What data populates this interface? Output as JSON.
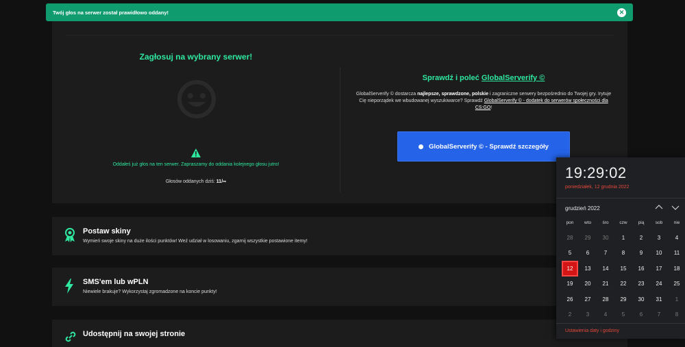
{
  "toast": {
    "message": "Twój głos na serwer został prawidłowo oddany!"
  },
  "vote": {
    "title": "Zagłosuj na wybrany serwer!",
    "message": "Oddałeś już głos na ten serwer. Zapraszamy do oddania kolejnego głosu jutro!",
    "votes_label": "Głosów oddanych dziś:",
    "votes_value": "11/∞"
  },
  "globalserverify": {
    "title_prefix": "Sprawdź i poleć",
    "title_link": "GlobalServerify ©",
    "desc_1": "GlobalServerify © dostarcza",
    "desc_bold": "najlepsze, sprawdzone, polskie",
    "desc_2": "i zagraniczne serwery bezpośrednio do Twojej gry.",
    "desc_3": "Irytuje Cię nieporządek we wbudowanej wyszukiwarce? Sprawdź",
    "desc_link": "GlobalServerify © - dodatek do serwerów społeczności dla CS:GO",
    "desc_end": "!",
    "button_label": "GlobalServerify © - Sprawdź szczegóły",
    "accent": "#2563e8"
  },
  "features": [
    {
      "title": "Postaw skiny",
      "desc": "Wymień swoje skiny na duże ilości punktów! Weź udział w losowaniu, zgarnij wszystkie postawione itemy!",
      "icon": "award-icon"
    },
    {
      "title": "SMS'em lub wPLN",
      "desc": "Niewiele brakuje? Wykorzystaj zgromadzone na koncie punkty!",
      "icon": "lightning-icon"
    },
    {
      "title": "Udostępnij na swojej stronie",
      "desc": "",
      "icon": "link-icon"
    }
  ],
  "calendar": {
    "time": "19:29:02",
    "date_long": "poniedziałek, 12 grudnia 2022",
    "month": "grudzień 2022",
    "weekdays": [
      "pon",
      "wto",
      "śro",
      "czw",
      "pią",
      "sob",
      "nie"
    ],
    "days": [
      {
        "d": "28",
        "other": true
      },
      {
        "d": "29",
        "other": true
      },
      {
        "d": "30",
        "other": true
      },
      {
        "d": "1"
      },
      {
        "d": "2"
      },
      {
        "d": "3"
      },
      {
        "d": "4"
      },
      {
        "d": "5"
      },
      {
        "d": "6"
      },
      {
        "d": "7"
      },
      {
        "d": "8"
      },
      {
        "d": "9"
      },
      {
        "d": "10"
      },
      {
        "d": "11"
      },
      {
        "d": "12",
        "today": true
      },
      {
        "d": "13"
      },
      {
        "d": "14"
      },
      {
        "d": "15"
      },
      {
        "d": "16"
      },
      {
        "d": "17"
      },
      {
        "d": "18"
      },
      {
        "d": "19"
      },
      {
        "d": "20"
      },
      {
        "d": "21"
      },
      {
        "d": "22"
      },
      {
        "d": "23"
      },
      {
        "d": "24"
      },
      {
        "d": "25"
      },
      {
        "d": "26"
      },
      {
        "d": "27"
      },
      {
        "d": "28"
      },
      {
        "d": "29"
      },
      {
        "d": "30"
      },
      {
        "d": "31"
      },
      {
        "d": "1",
        "other": true
      },
      {
        "d": "2",
        "other": true
      },
      {
        "d": "3",
        "other": true
      },
      {
        "d": "4",
        "other": true
      },
      {
        "d": "5",
        "other": true
      },
      {
        "d": "6",
        "other": true
      },
      {
        "d": "7",
        "other": true
      },
      {
        "d": "8",
        "other": true
      }
    ],
    "settings_link": "Ustawienia daty i godziny",
    "accent": "#e3493b"
  },
  "colors": {
    "success": "#0f9b6e",
    "green_text": "#2ee8a0",
    "today": "#d41515"
  }
}
